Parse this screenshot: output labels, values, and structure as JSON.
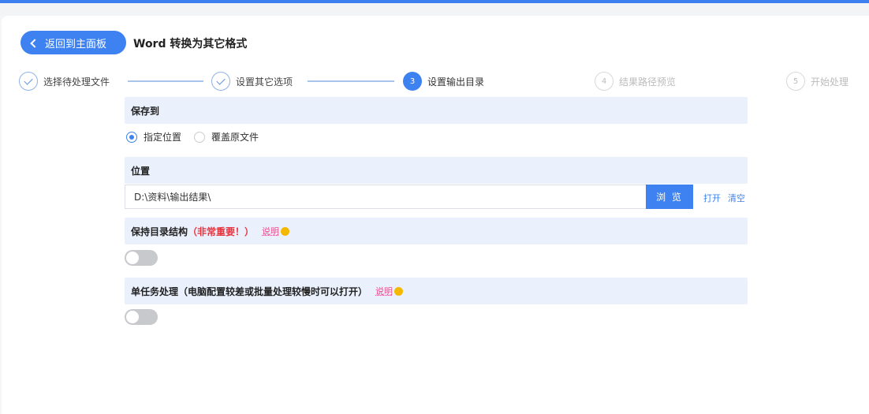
{
  "header": {
    "back_label": "返回到主面板",
    "title": "Word 转换为其它格式"
  },
  "steps": [
    {
      "number": "1",
      "label": "选择待处理文件",
      "state": "done"
    },
    {
      "number": "2",
      "label": "设置其它选项",
      "state": "done"
    },
    {
      "number": "3",
      "label": "设置输出目录",
      "state": "active"
    },
    {
      "number": "4",
      "label": "结果路径预览",
      "state": "todo"
    },
    {
      "number": "5",
      "label": "开始处理",
      "state": "todo"
    }
  ],
  "save_to": {
    "heading": "保存到",
    "options": [
      "指定位置",
      "覆盖原文件"
    ],
    "selected": "指定位置"
  },
  "location": {
    "heading": "位置",
    "path": "D:\\资料\\输出结果\\",
    "browse_label": "浏 览",
    "open_label": "打开",
    "clear_label": "清空"
  },
  "keep_structure": {
    "heading": "保持目录结构",
    "warning": "（非常重要！）",
    "explain_label": "说明",
    "enabled": false
  },
  "single_task": {
    "heading": "单任务处理（电脑配置较差或批量处理较慢时可以打开）",
    "explain_label": "说明",
    "enabled": false
  },
  "colors": {
    "accent": "#3d82f0",
    "section_bg": "#eaf1fd",
    "warning": "#e8323c",
    "explain": "#ea4c89",
    "toggle_off": "#c8c9cc"
  }
}
